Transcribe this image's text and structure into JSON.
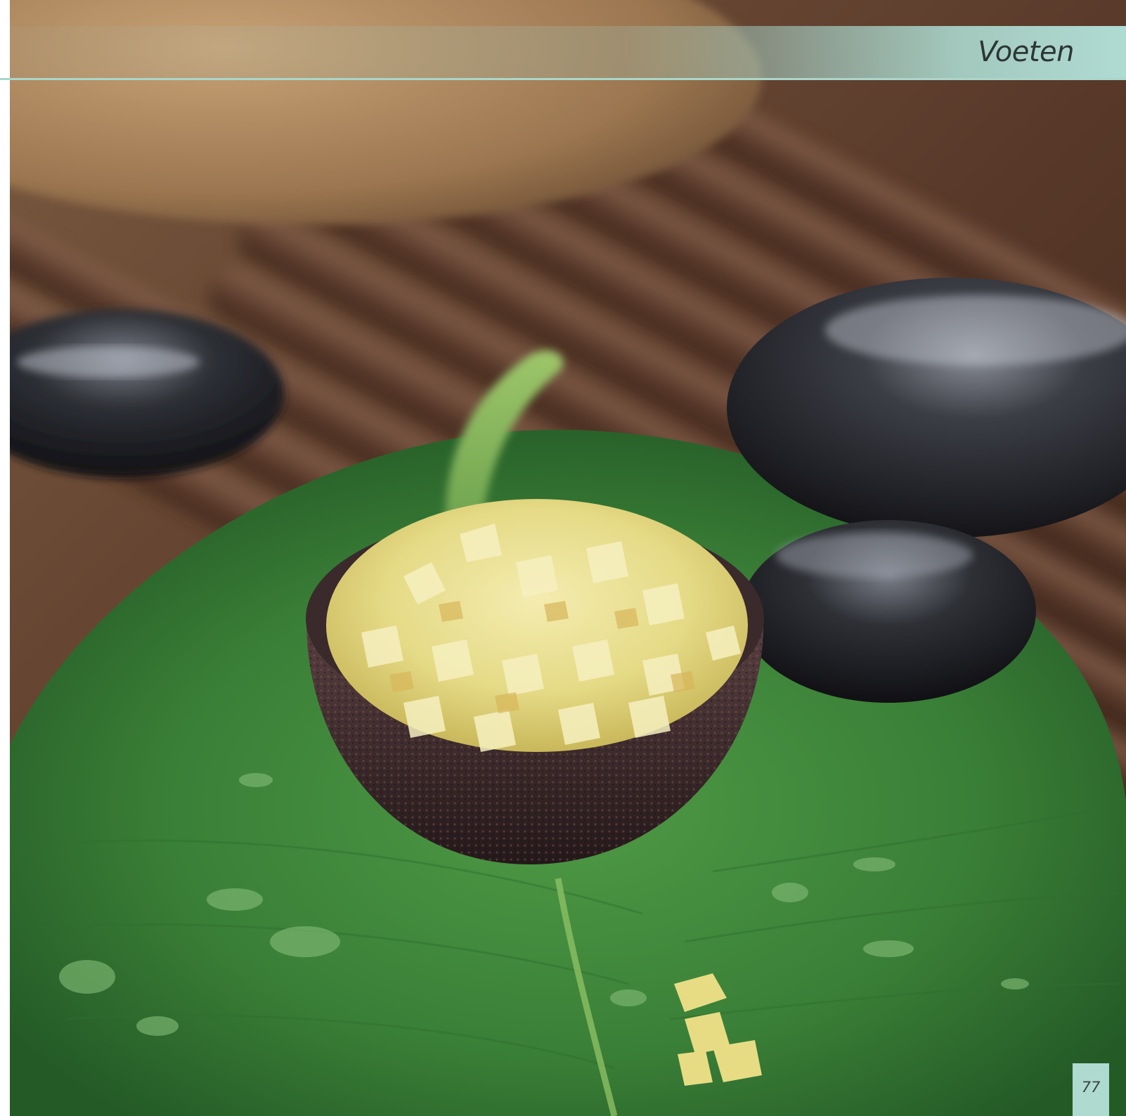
{
  "header": {
    "chapter_title": "Voeten"
  },
  "footer": {
    "page_number": "77"
  },
  "photo": {
    "subject": "spa-salt-bowl-photo",
    "colors": {
      "leaf": "#3f8a3c",
      "leaf_dark": "#24592a",
      "bamboo": "#6b4633",
      "stone": "#1d1d22",
      "salt": "#e9e08f",
      "bowl": "#3a2a2c",
      "header_accent": "#a9d6cb"
    }
  }
}
